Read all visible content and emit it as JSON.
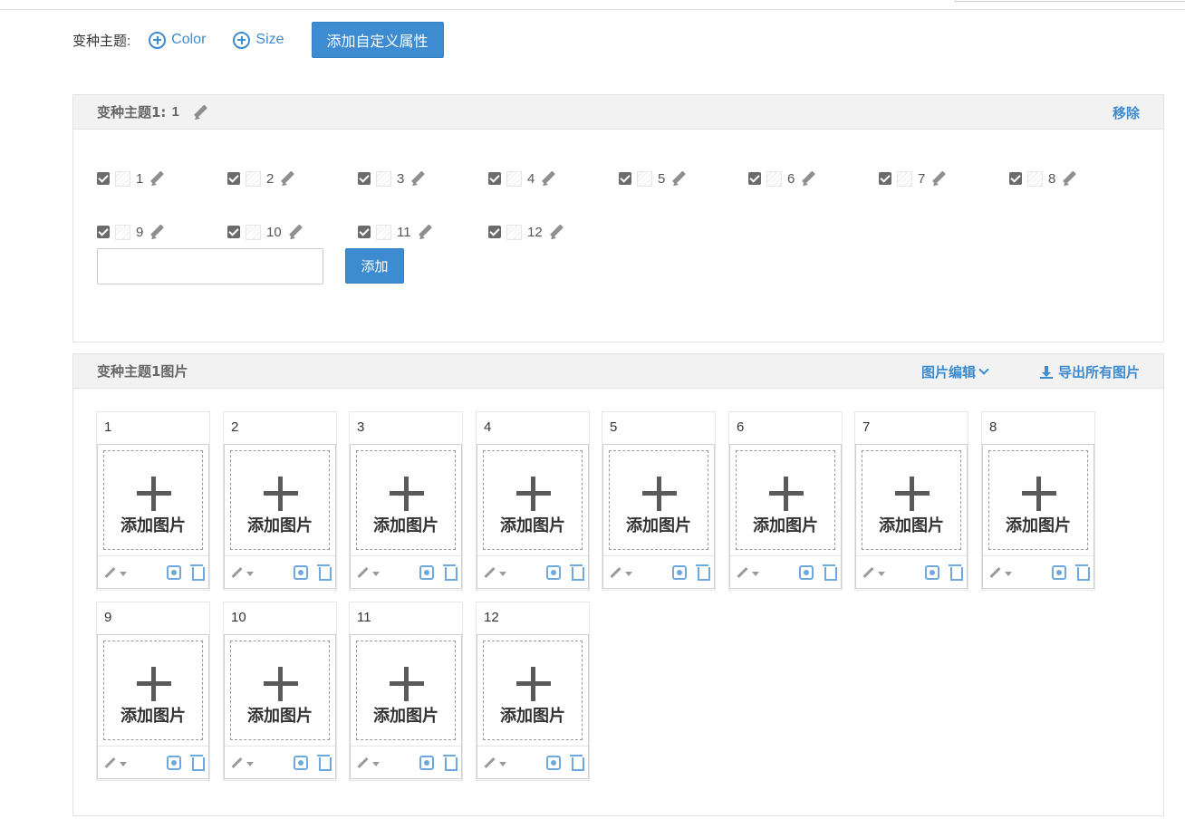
{
  "theme_row": {
    "label": "变种主题:",
    "add_color": "Color",
    "add_size": "Size",
    "custom_button": "添加自定义属性"
  },
  "theme_panel": {
    "title": "变种主题1:",
    "title_value": "1",
    "remove": "移除",
    "options": [
      {
        "label": "1",
        "checked": true
      },
      {
        "label": "2",
        "checked": true
      },
      {
        "label": "3",
        "checked": true
      },
      {
        "label": "4",
        "checked": true
      },
      {
        "label": "5",
        "checked": true
      },
      {
        "label": "6",
        "checked": true
      },
      {
        "label": "7",
        "checked": true
      },
      {
        "label": "8",
        "checked": true
      },
      {
        "label": "9",
        "checked": true
      },
      {
        "label": "10",
        "checked": true
      },
      {
        "label": "11",
        "checked": true
      },
      {
        "label": "12",
        "checked": true
      }
    ],
    "input_value": "",
    "add_button": "添加"
  },
  "image_panel": {
    "title": "变种主题1图片",
    "edit_menu": "图片编辑",
    "export_all": "导出所有图片",
    "add_image_label": "添加图片",
    "cards": [
      "1",
      "2",
      "3",
      "4",
      "5",
      "6",
      "7",
      "8",
      "9",
      "10",
      "11",
      "12"
    ]
  },
  "colors": {
    "accent": "#3d8bd0",
    "panel_header": "#f2f2f2",
    "checkbox": "#6b6b6b"
  }
}
